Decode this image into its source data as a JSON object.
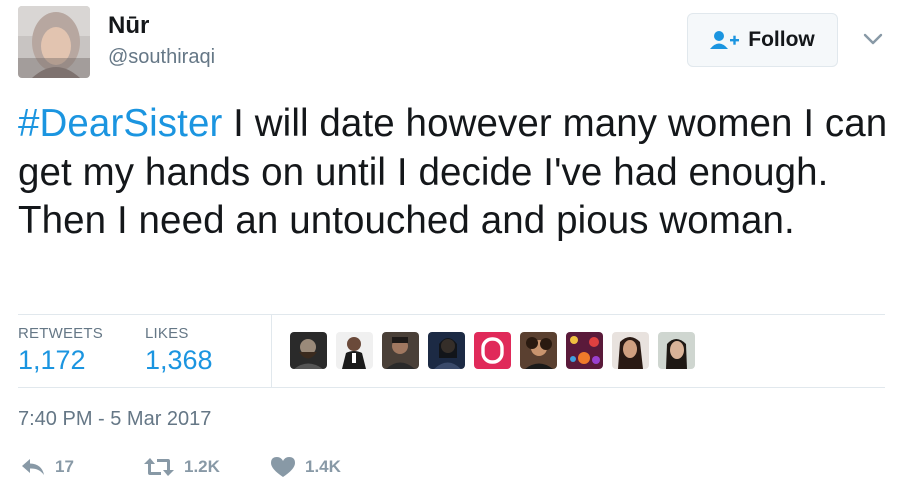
{
  "user": {
    "display_name": "Nūr",
    "handle": "@southiraqi"
  },
  "follow_button": {
    "label": "Follow"
  },
  "tweet": {
    "hashtag": "#DearSister",
    "text": " I will date however many women I can get my hands on until I decide I've had enough. Then I need an untouched and pious woman."
  },
  "stats": {
    "retweets_label": "RETWEETS",
    "retweets_value": "1,172",
    "likes_label": "LIKES",
    "likes_value": "1,368"
  },
  "likers": [
    {
      "icon": "avatar-bearded-man"
    },
    {
      "icon": "avatar-man-suit"
    },
    {
      "icon": "avatar-man-dark"
    },
    {
      "icon": "avatar-woman-night"
    },
    {
      "icon": "avatar-instagram-logo"
    },
    {
      "icon": "avatar-woman-curly"
    },
    {
      "icon": "avatar-party-lights"
    },
    {
      "icon": "avatar-woman-long-hair"
    },
    {
      "icon": "avatar-woman-selfie"
    }
  ],
  "timestamp": "7:40 PM - 5 Mar 2017",
  "actions": {
    "reply_count": "17",
    "retweet_count": "1.2K",
    "like_count": "1.4K"
  },
  "colors": {
    "link_blue": "#1b95e0",
    "muted_gray": "#657786",
    "icon_gray": "#8899a6",
    "border": "#e1e8ed"
  }
}
